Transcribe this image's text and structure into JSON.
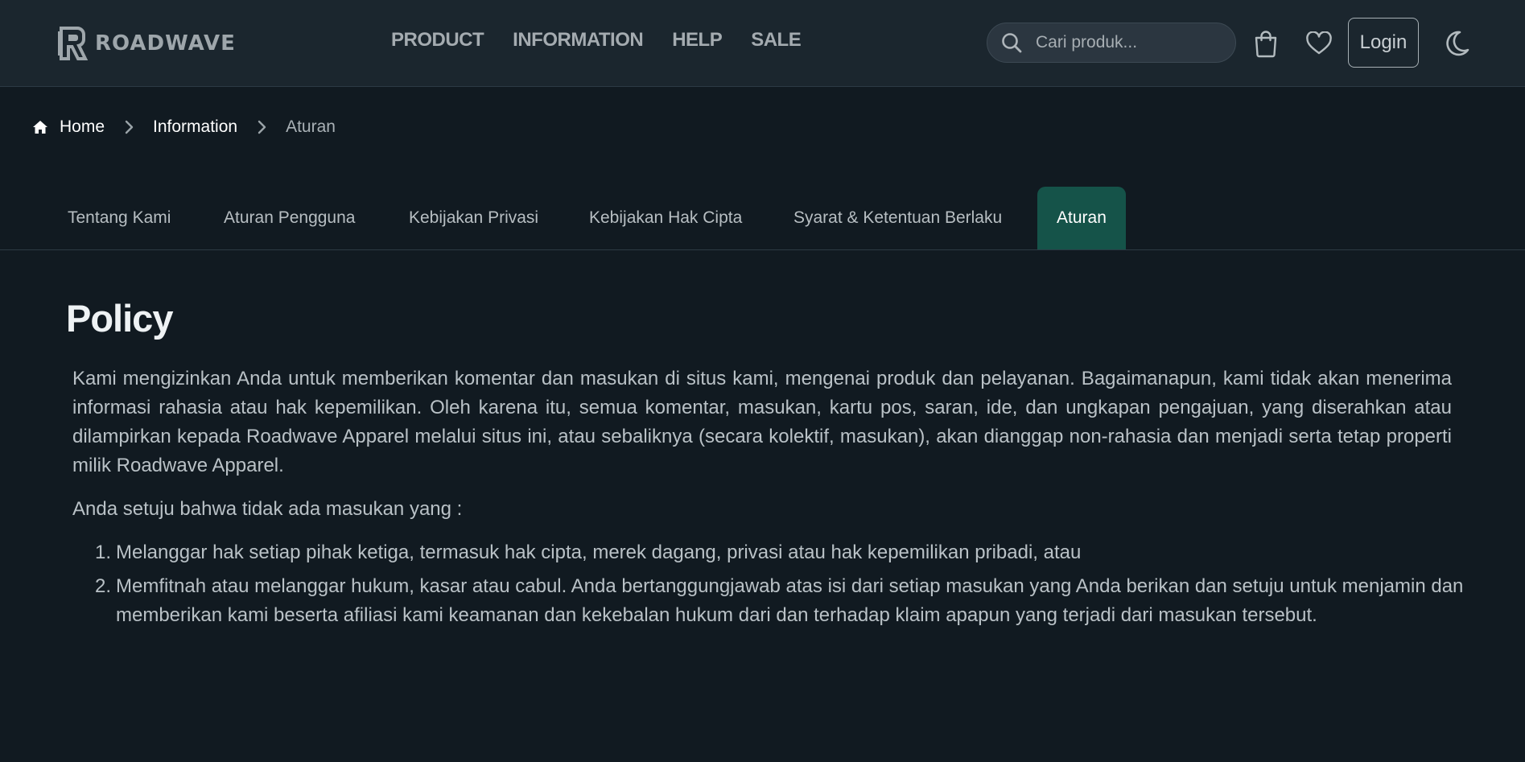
{
  "header": {
    "brand": "ROADWAVE",
    "nav": [
      {
        "label": "PRODUCT"
      },
      {
        "label": "INFORMATION"
      },
      {
        "label": "HELP"
      },
      {
        "label": "SALE"
      }
    ],
    "search": {
      "placeholder": "Cari produk..."
    },
    "login_label": "Login"
  },
  "breadcrumb": {
    "home": "Home",
    "information": "Information",
    "current": "Aturan"
  },
  "tabs": [
    {
      "label": "Tentang Kami",
      "active": false
    },
    {
      "label": "Aturan Pengguna",
      "active": false
    },
    {
      "label": "Kebijakan Privasi",
      "active": false
    },
    {
      "label": "Kebijakan Hak Cipta",
      "active": false
    },
    {
      "label": "Syarat & Ketentuan Berlaku",
      "active": false
    },
    {
      "label": "Aturan",
      "active": true
    }
  ],
  "content": {
    "title": "Policy",
    "paragraph": "Kami mengizinkan Anda untuk memberikan komentar dan masukan di situs kami, mengenai produk dan pelayanan. Bagaimanapun, kami tidak akan menerima informasi rahasia atau hak kepemilikan. Oleh karena itu, semua komentar, masukan, kartu pos, saran, ide, dan ungkapan pengajuan, yang diserahkan atau dilampirkan kepada Roadwave Apparel melalui situs ini, atau sebaliknya (secara kolektif, masukan), akan dianggap non-rahasia dan menjadi serta tetap properti milik Roadwave Apparel.",
    "lead": "Anda setuju bahwa tidak ada masukan yang :",
    "rules": [
      {
        "num": "1.",
        "text": "Melanggar hak setiap pihak ketiga, termasuk hak cipta, merek dagang, privasi atau hak kepemilikan pribadi, atau"
      },
      {
        "num": "2.",
        "text": "Memfitnah atau melanggar hukum, kasar atau cabul. Anda bertanggungjawab atas isi dari setiap masukan yang Anda berikan dan setuju untuk menjamin dan memberikan kami beserta afiliasi kami keamanan dan kekebalan hukum dari dan terhadap klaim apapun yang terjadi dari masukan tersebut."
      }
    ]
  },
  "theme": {
    "background": "#111a21",
    "header_bg": "#1b262e",
    "accent": "#155349"
  },
  "icons": {
    "logo": "roadwave-logo-icon",
    "search": "search-icon",
    "cart": "shopping-bag-icon",
    "wishlist": "heart-icon",
    "theme_toggle": "moon-icon",
    "home": "home-icon",
    "separator": "chevron-right-icon"
  }
}
